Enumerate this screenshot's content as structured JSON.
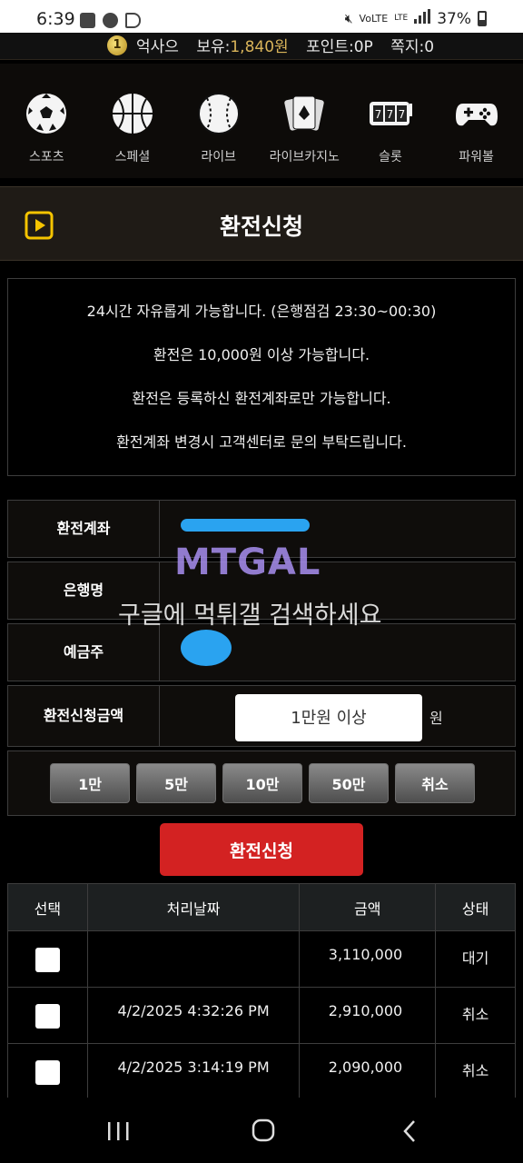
{
  "status": {
    "time": "6:39",
    "network": "LTE",
    "battery": "37%"
  },
  "user": {
    "level": "1",
    "name": "억사으",
    "balance_label": "보유:",
    "balance_value": "1,840원",
    "points": "포인트:0P",
    "messages": "쪽지:0"
  },
  "menu": [
    {
      "label": "스포츠",
      "icon": "soccer-ball-icon"
    },
    {
      "label": "스페셜",
      "icon": "basketball-icon"
    },
    {
      "label": "라이브",
      "icon": "baseball-icon"
    },
    {
      "label": "라이브카지노",
      "icon": "playing-cards-icon"
    },
    {
      "label": "슬롯",
      "icon": "slot-machine-icon"
    },
    {
      "label": "파워볼",
      "icon": "gamepad-icon"
    }
  ],
  "page_title": "환전신청",
  "notice": [
    "24시간 자유롭게 가능합니다. (은행점검 23:30~00:30)",
    "환전은 10,000원 이상 가능합니다.",
    "환전은 등록하신 환전계좌로만 가능합니다.",
    "환전계좌 변경시 고객센터로 문의 부탁드립니다."
  ],
  "form": {
    "account_label": "환전계좌",
    "bank_label": "은행명",
    "holder_label": "예금주",
    "amount_label": "환전신청금액",
    "amount_placeholder": "1만원 이상",
    "currency": "원"
  },
  "quick_buttons": [
    "1만",
    "5만",
    "10만",
    "50만",
    "취소"
  ],
  "submit_label": "환전신청",
  "table": {
    "headers": [
      "선택",
      "처리날짜",
      "금액",
      "상태"
    ],
    "rows": [
      {
        "date": "",
        "amount": "3,110,000",
        "status": "대기"
      },
      {
        "date": "4/2/2025 4:32:26 PM",
        "amount": "2,910,000",
        "status": "취소"
      },
      {
        "date": "4/2/2025 3:14:19 PM",
        "amount": "2,090,000",
        "status": "취소"
      }
    ]
  },
  "watermark": {
    "logo": "MTGAL",
    "text": "구글에 먹튀갤 검색하세요"
  },
  "colors": {
    "accent_red": "#d32222",
    "gold": "#d9b45a",
    "panel": "#1f1b16"
  }
}
